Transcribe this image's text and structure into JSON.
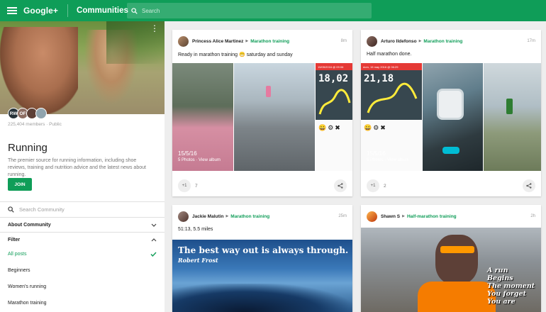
{
  "topbar": {
    "brand": "Google+",
    "section": "Communities",
    "search_placeholder": "Search"
  },
  "sidebar": {
    "avatar_labels": [
      "RW",
      "OF"
    ],
    "members": "225,404 members · Public",
    "title": "Running",
    "description": "The premier source for running information, including shoe reviews, training and nutrition advice and the latest news about running.",
    "join_label": "JOIN",
    "search_placeholder": "Search Community",
    "about_label": "About Community",
    "filter_label": "Filter",
    "filters": [
      {
        "label": "All posts",
        "active": true
      },
      {
        "label": "Beginners",
        "active": false
      },
      {
        "label": "Women's running",
        "active": false
      },
      {
        "label": "Marathon training",
        "active": false
      }
    ]
  },
  "posts": [
    {
      "author": "Princess Alice Martinez",
      "category": "Marathon training",
      "time": "8m",
      "text": "Ready in marathon training 😁 saturday and sunday",
      "album_date": "15/5/16",
      "album_sub": "5 Photos · View album",
      "phone_time": "18,02",
      "phone_date": "15/05/2016 @ 09:06",
      "plus_label": "+1",
      "plus_count": "7"
    },
    {
      "author": "Arturo Ildefonso",
      "category": "Marathon training",
      "time": "17m",
      "text": "Half marathon done.",
      "album_date": "15/5/16",
      "album_sub": "5 Photos · View album",
      "phone_time": "21,18",
      "phone_date": "dom, 15 may 2016 @ 06:29",
      "plus_label": "+1",
      "plus_count": "2"
    },
    {
      "author": "Jackie Malutin",
      "category": "Marathon training",
      "time": "25m",
      "text": "51:13, 5.5 miles",
      "quote": "The best way out is always through.",
      "quote_author": "Robert Frost"
    },
    {
      "author": "Shawn S",
      "category": "Half-marathon training",
      "time": "2h",
      "poem": [
        "A run",
        "Begins",
        "The moment",
        "You forget",
        "You are"
      ]
    }
  ],
  "colors": {
    "brand_green": "#0f9d58",
    "background": "#eeeeee",
    "card": "#ffffff"
  }
}
